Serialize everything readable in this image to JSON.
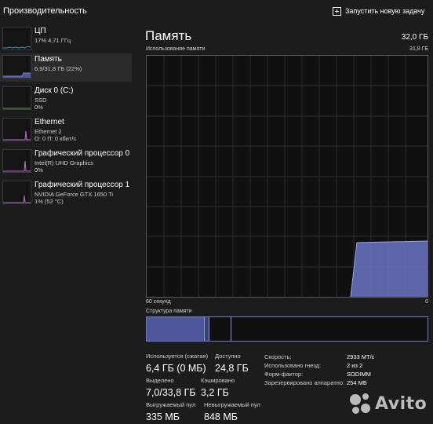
{
  "header": {
    "title": "Производительность",
    "run_task_label": "Запустить новую задачу"
  },
  "sidebar": {
    "items": [
      {
        "name": "ЦП",
        "sub1": "17% 4,71 ГГц",
        "sub2": "",
        "color": "#2b9ad6"
      },
      {
        "name": "Память",
        "sub1": "6,9/31,8 ГБ (22%)",
        "sub2": "",
        "color": "#7b86d9"
      },
      {
        "name": "Диск 0 (C:)",
        "sub1": "SSD",
        "sub2": "0%",
        "color": "#5fa84f"
      },
      {
        "name": "Ethernet",
        "sub1": "Ethernet 2",
        "sub2": "О: 0 П: 0 кбит/с",
        "color": "#c06bd0"
      },
      {
        "name": "Графический процессор 0",
        "sub1": "Intel(R) UHD Graphics",
        "sub2": "0%",
        "color": "#c06bd0"
      },
      {
        "name": "Графический процессор 1",
        "sub1": "NVIDIA GeForce GTX 1650 Ti",
        "sub2": "1% (52 °C)",
        "color": "#c06bd0"
      }
    ]
  },
  "main": {
    "title": "Память",
    "total": "32,0 ГБ",
    "usage_label": "Использование памяти",
    "usage_max": "31,8 ГБ",
    "axis_left": "60 секунд",
    "axis_right": "0",
    "structure_label": "Структура памяти",
    "accent_color": "#7b86d9"
  },
  "stats": {
    "in_use_label": "Используется (сжатая)",
    "in_use_value": "6,4 ГБ (0 МБ)",
    "available_label": "Доступно",
    "available_value": "24,8 ГБ",
    "committed_label": "Выделено",
    "committed_value": "7,0/33,8 ГБ",
    "cached_label": "Кэшировано",
    "cached_value": "3,2 ГБ",
    "paged_label": "Выгружаемый пул",
    "paged_value": "335 МБ",
    "nonpaged_label": "Невыгружаемый пул",
    "nonpaged_value": "848 МБ"
  },
  "details": {
    "speed_label": "Скорость:",
    "speed_value": "2933 МТ/с",
    "slots_label": "Использовано гнезд:",
    "slots_value": "2 из 2",
    "form_label": "Форм-фактор:",
    "form_value": "SODIMM",
    "reserved_label": "Зарезервировано аппаратно:",
    "reserved_value": "254 МБ"
  },
  "watermark": {
    "text": "Avito"
  }
}
